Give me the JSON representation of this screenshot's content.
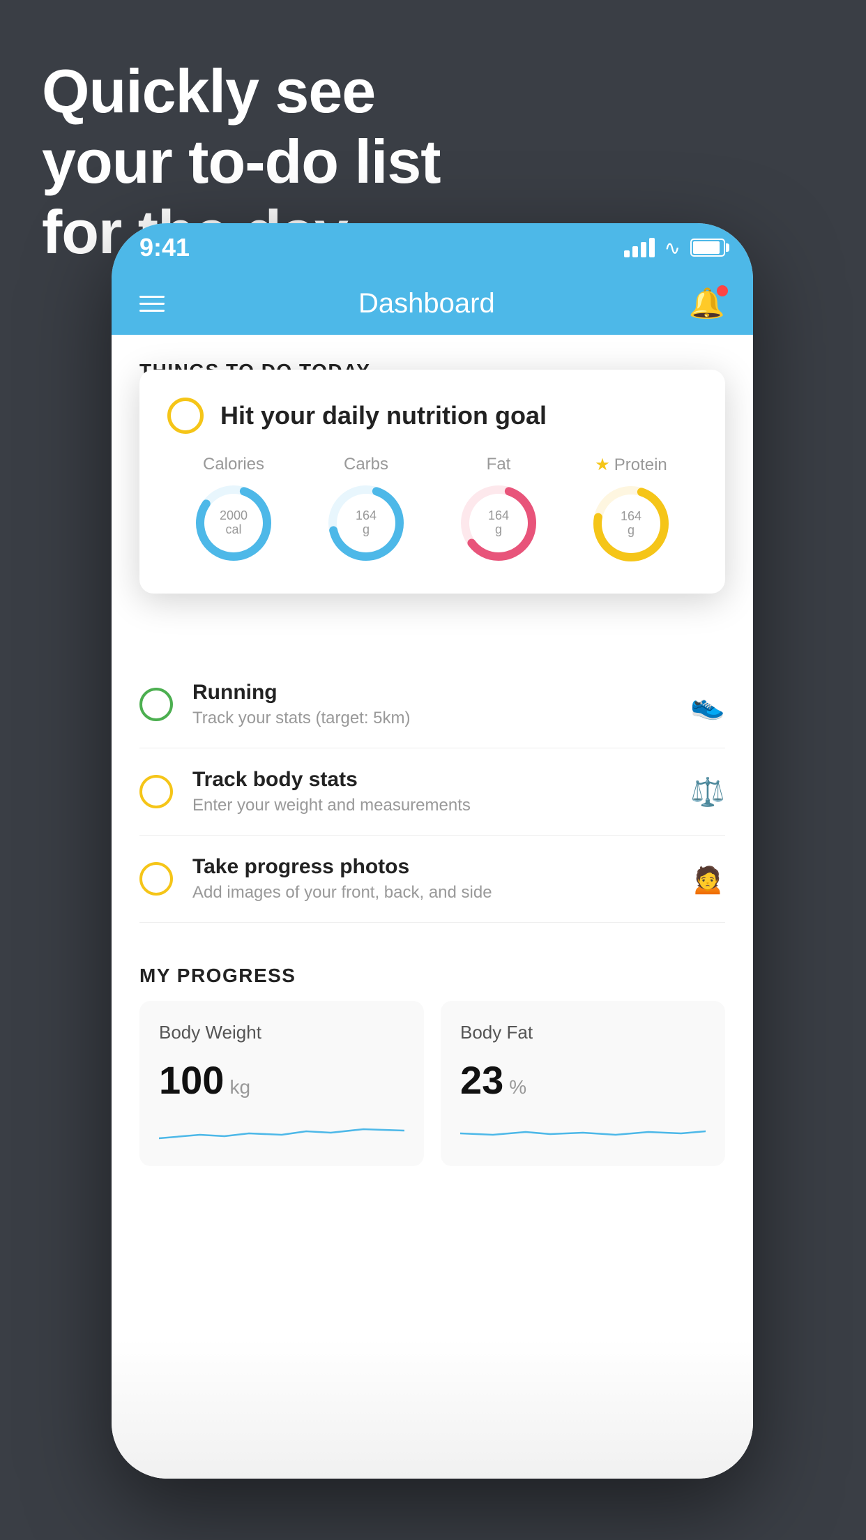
{
  "hero": {
    "line1": "Quickly see",
    "line2": "your to-do list",
    "line3": "for the day."
  },
  "statusBar": {
    "time": "9:41"
  },
  "header": {
    "title": "Dashboard"
  },
  "thingsToday": {
    "sectionLabel": "THINGS TO DO TODAY"
  },
  "nutritionCard": {
    "title": "Hit your daily nutrition goal",
    "calories": {
      "label": "Calories",
      "value": "2000",
      "unit": "cal"
    },
    "carbs": {
      "label": "Carbs",
      "value": "164",
      "unit": "g"
    },
    "fat": {
      "label": "Fat",
      "value": "164",
      "unit": "g"
    },
    "protein": {
      "label": "Protein",
      "value": "164",
      "unit": "g"
    }
  },
  "todoItems": [
    {
      "title": "Running",
      "sub": "Track your stats (target: 5km)",
      "circleColor": "green",
      "icon": "shoe"
    },
    {
      "title": "Track body stats",
      "sub": "Enter your weight and measurements",
      "circleColor": "yellow",
      "icon": "scale"
    },
    {
      "title": "Take progress photos",
      "sub": "Add images of your front, back, and side",
      "circleColor": "yellow",
      "icon": "person"
    }
  ],
  "progress": {
    "sectionLabel": "MY PROGRESS",
    "bodyWeight": {
      "label": "Body Weight",
      "value": "100",
      "unit": "kg"
    },
    "bodyFat": {
      "label": "Body Fat",
      "value": "23",
      "unit": "%"
    }
  }
}
